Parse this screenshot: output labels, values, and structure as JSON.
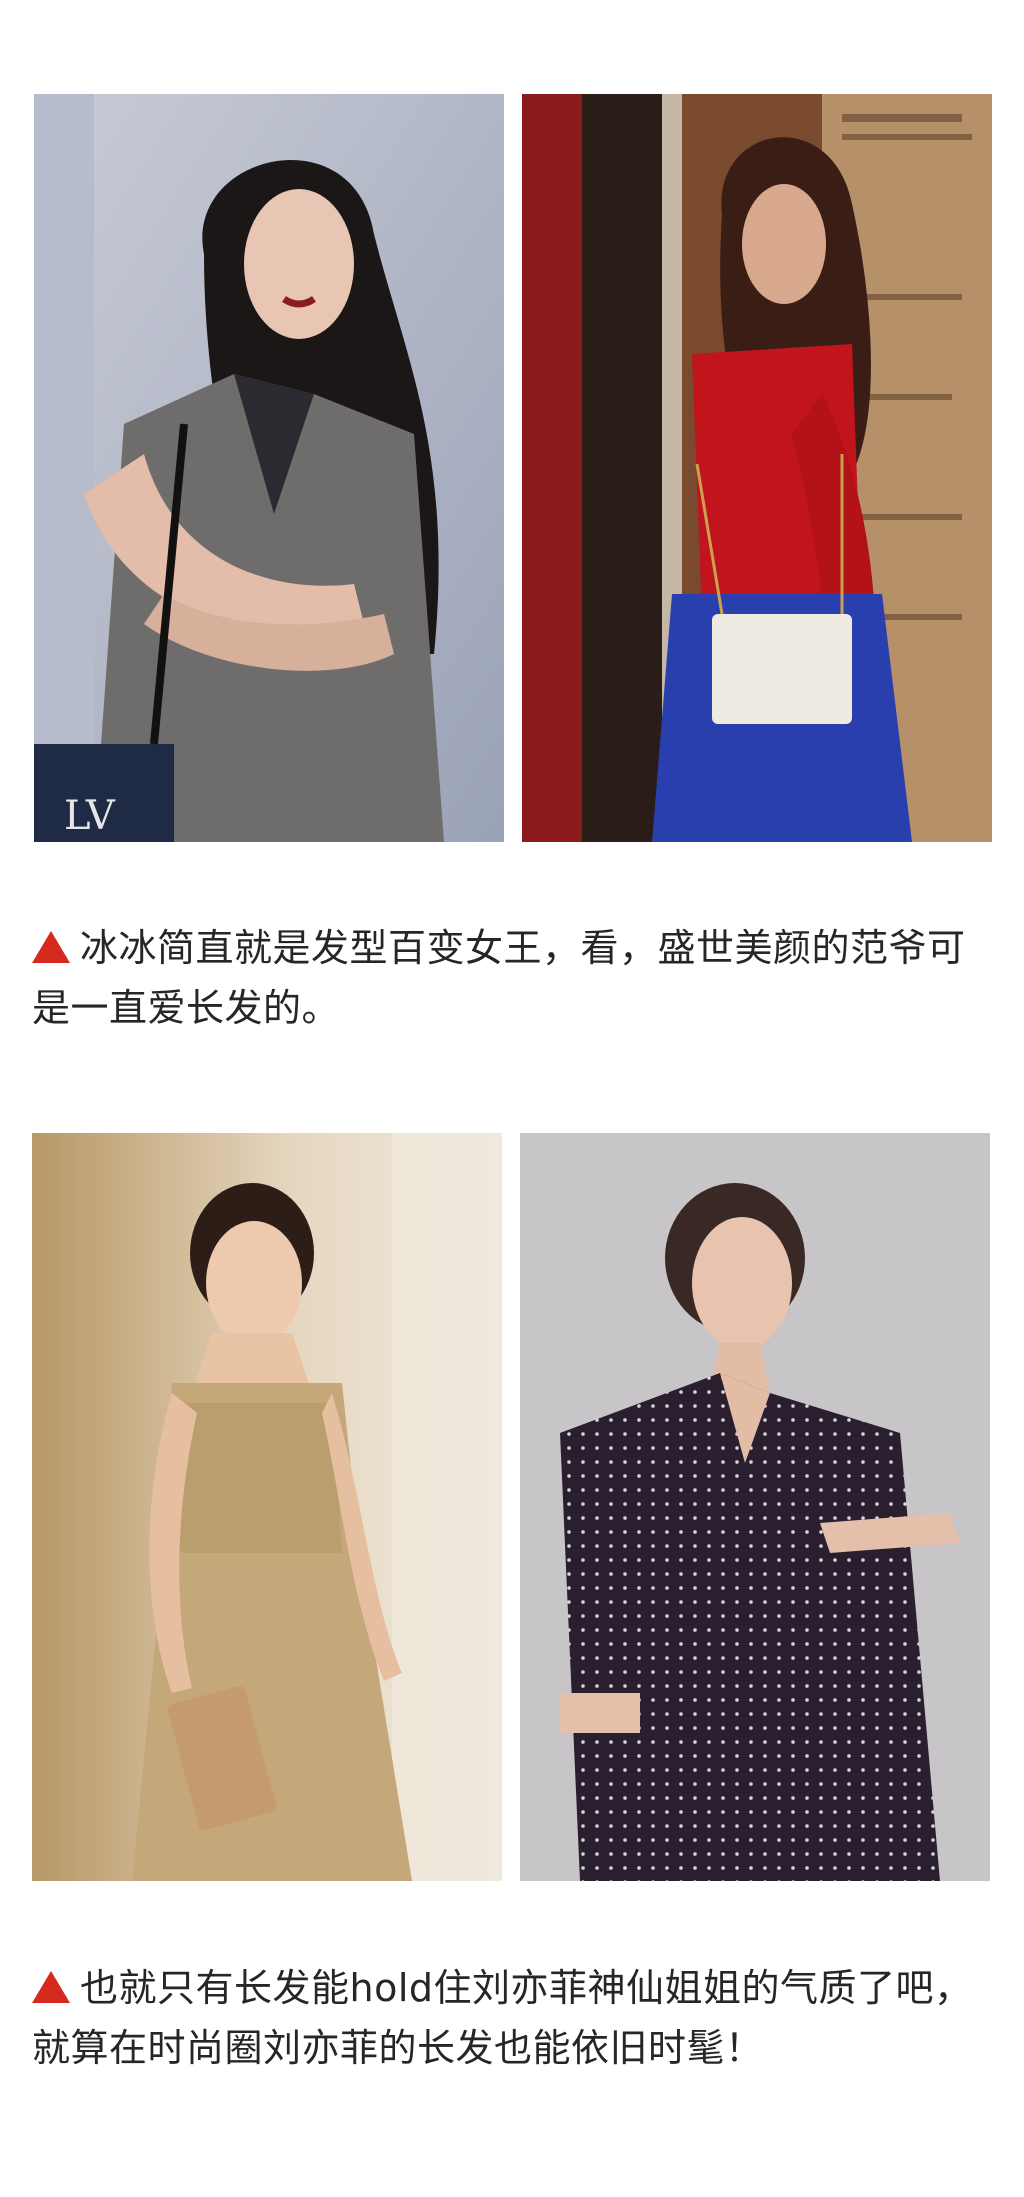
{
  "section1": {
    "photo_left_alt": "Fan Bingbing in grey sleeveless coat with long wavy hair",
    "photo_right_alt": "Fan Bingbing in red sweater and blue skirt in doorway",
    "caption": "冰冰简直就是发型百变女王，看，盛世美颜的范爷可是一直爱长发的。",
    "marker_color": "#d42a1e"
  },
  "section2": {
    "photo_left_alt": "Liu Yifei in gold embroidered gown with clutch",
    "photo_right_alt": "Liu Yifei in dark polka-dot blazer against grey wall",
    "caption": "也就只有长发能hold住刘亦菲神仙姐姐的气质了吧，就算在时尚圈刘亦菲的长发也能依旧时髦！",
    "marker_color": "#d42a1e"
  }
}
